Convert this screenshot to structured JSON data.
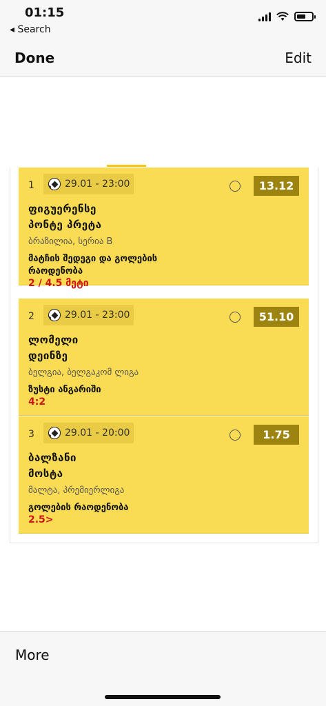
{
  "status_bar": {
    "time": "01:15",
    "back_label": "◂ Search"
  },
  "nav": {
    "done_label": "Done",
    "edit_label": "Edit"
  },
  "bets": [
    {
      "index": "1",
      "datetime": "29.01 - 23:00",
      "odds": "13.12",
      "team1": "ფიგუერენსე",
      "team2": "პონტე პრეტა",
      "league": "ბრაზილია, სერია B",
      "market": "მატჩის შედეგი და გოლების რაოდენობა",
      "pick": "2 / 4.5 მეტი"
    },
    {
      "index": "2",
      "datetime": "29.01 - 23:00",
      "odds": "51.10",
      "team1": "ლომელი",
      "team2": "დეინზე",
      "league": "ბელგია, ბელგაკომ ლიგა",
      "market": "ზუსტი ანგარიში",
      "pick": "4:2"
    },
    {
      "index": "3",
      "datetime": "29.01 - 20:00",
      "odds": "1.75",
      "team1": "ბალზანი",
      "team2": "მოსტა",
      "league": "მალტა, პრემიერლიგა",
      "market": "გოლების რაოდენობა",
      "pick": "2.5>"
    }
  ],
  "tab_bar": {
    "more_label": "More"
  },
  "colors": {
    "card": "#f9dc54",
    "odds_bg": "#9d8410",
    "pick": "#cc1414",
    "accent": "#f5c518"
  }
}
